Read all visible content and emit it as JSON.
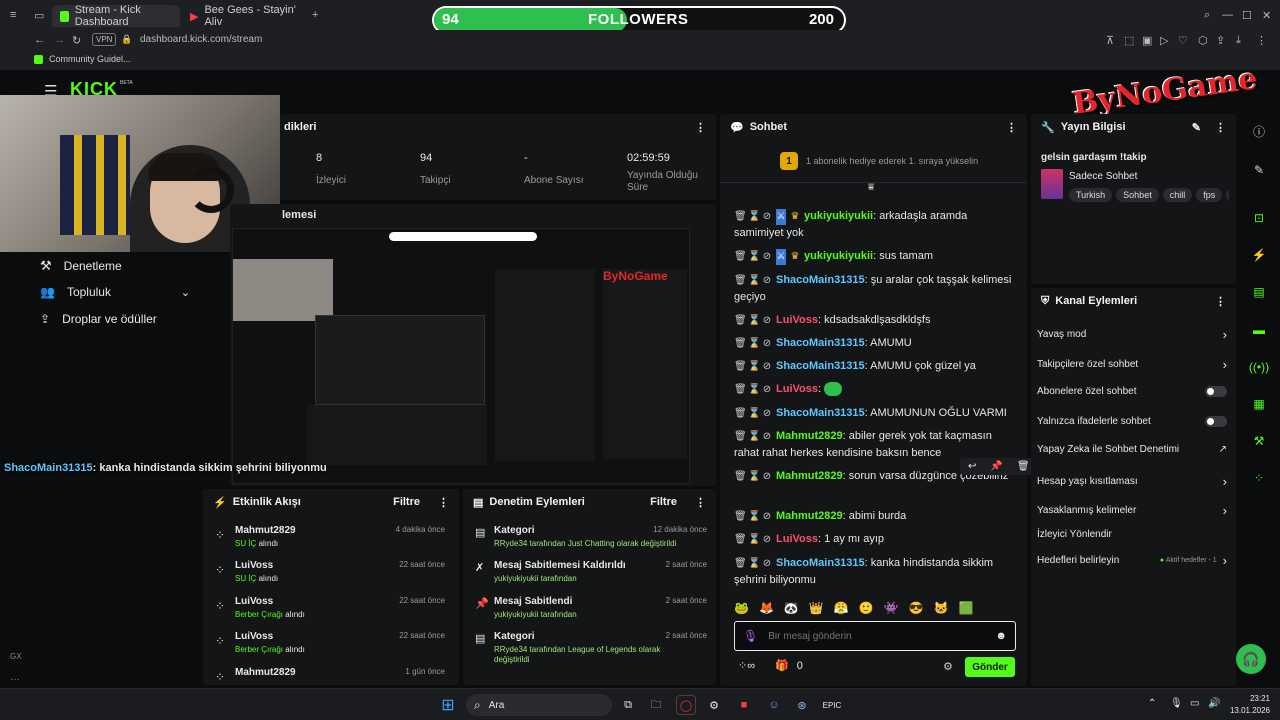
{
  "browser": {
    "tabs": [
      {
        "label": "Stream - Kick Dashboard"
      },
      {
        "label": "Bee Gees - Stayin' Aliv"
      }
    ],
    "url": "dashboard.kick.com/stream",
    "vpn": "VPN",
    "bookmark": "Community Guidel..."
  },
  "followers_bar": {
    "current": "94",
    "label": "FOLLOWERS",
    "goal": "200",
    "fraction": 0.47
  },
  "brand": {
    "logo": "KICK",
    "beta": "BETA",
    "overlay_watermark": "ByNoGame"
  },
  "stats": {
    "title": "dikleri",
    "items": [
      {
        "value": "8",
        "label": "İzleyici"
      },
      {
        "value": "94",
        "label": "Takipçi"
      },
      {
        "value": "-",
        "label": "Abone Sayısı"
      },
      {
        "value": "02:59:59",
        "label": "Yayında Olduğu Süre"
      }
    ]
  },
  "preview": {
    "title": "lemesi"
  },
  "sidebar": {
    "items": [
      {
        "label": "Denetleme"
      },
      {
        "label": "Topluluk"
      },
      {
        "label": "Droplar ve ödüller"
      }
    ]
  },
  "overlay_chat": {
    "user": "ShacoMain31315",
    "text": ": kanka hindistanda sikkim şehrini biliyonmu"
  },
  "activity": {
    "title": "Etkinlik Akışı",
    "filter": "Filtre",
    "items": [
      {
        "user": "Mahmut2829",
        "time": "4 dakika önce",
        "reward": "SU İÇ",
        "suffix": "alındı"
      },
      {
        "user": "LuiVoss",
        "time": "22 saat önce",
        "reward": "SU İÇ",
        "suffix": "alındı"
      },
      {
        "user": "LuiVoss",
        "time": "22 saat önce",
        "reward": "Berber Çırağı",
        "suffix": "alındı"
      },
      {
        "user": "LuiVoss",
        "time": "22 saat önce",
        "reward": "Berber Çırağı",
        "suffix": "alındı"
      },
      {
        "user": "Mahmut2829",
        "time": "1 gün önce",
        "reward": "",
        "suffix": ""
      }
    ]
  },
  "moderation": {
    "title": "Denetim Eylemleri",
    "filter": "Filtre",
    "items": [
      {
        "title": "Kategori",
        "time": "12 dakika önce",
        "line": "RRyde34 tarafından Just Chatting olarak değiştirildi"
      },
      {
        "title": "Mesaj Sabitlemesi Kaldırıldı",
        "time": "2 saat önce",
        "line": "yukiyukiyukii tarafından"
      },
      {
        "title": "Mesaj Sabitlendi",
        "time": "2 saat önce",
        "line": "yukiyukiyukii tarafından"
      },
      {
        "title": "Kategori",
        "time": "2 saat önce",
        "line": "RRyde34 tarafından League of Legends olarak değiştirildi"
      }
    ]
  },
  "chat": {
    "title": "Sohbet",
    "pinned": "1 abonelik hediye ederek 1. sıraya yükselin",
    "pinned_count": "1",
    "messages": [
      {
        "user": "yukiyukiyukii",
        "text": ": arkadaşla aramda samimiyet yok",
        "color": "#53fc18"
      },
      {
        "user": "yukiyukiyukii",
        "text": ": sus tamam",
        "color": "#53fc18"
      },
      {
        "user": "ShacoMain31315",
        "text": ": şu aralar çok taşşak kelimesi geçiyo",
        "color": "#5ec8ff"
      },
      {
        "user": "LuiVoss",
        "text": ": kdsadsakdlşasdkldşfs",
        "color": "#ff4d6d"
      },
      {
        "user": "ShacoMain31315",
        "text": ": AMUMU",
        "color": "#5ec8ff"
      },
      {
        "user": "ShacoMain31315",
        "text": ": AMUMU çok güzel ya",
        "color": "#5ec8ff"
      },
      {
        "user": "LuiVoss",
        "text": ":",
        "color": "#ff4d6d"
      },
      {
        "user": "ShacoMain31315",
        "text": ": AMUMUNUN OĞLU VARMI",
        "color": "#5ec8ff"
      },
      {
        "user": "Mahmut2829",
        "text": ": abiler gerek yok tat kaçmasın rahat rahat herkes kendisine baksın bence",
        "color": "#53fc18"
      },
      {
        "user": "Mahmut2829",
        "text": ": sorun varsa düzgünce çözebiliriz",
        "color": "#53fc18"
      },
      {
        "user": "Mahmut2829",
        "text": ": abimi burda",
        "color": "#53fc18"
      },
      {
        "user": "LuiVoss",
        "text": ": 1 ay mı ayıp",
        "color": "#ff4d6d"
      },
      {
        "user": "ShacoMain31315",
        "text": ": kanka hindistanda sikkim şehrini biliyonmu",
        "color": "#5ec8ff"
      }
    ],
    "input_placeholder": "Bir mesaj gönderin",
    "points": "0",
    "send": "Gönder"
  },
  "stream_info": {
    "title": "Yayın Bilgisi",
    "stream_title": "gelsin gardaşım !takip",
    "category": "Sadece Sohbet",
    "tags": [
      "Turkish",
      "Sohbet",
      "chill",
      "fps",
      "g"
    ]
  },
  "channel_actions": {
    "title": "Kanal Eylemleri",
    "items": [
      {
        "label": "Yavaş mod",
        "kind": "arrow"
      },
      {
        "label": "Takipçilere özel sohbet",
        "kind": "arrow"
      },
      {
        "label": "Abonelere özel sohbet",
        "kind": "toggle"
      },
      {
        "label": "Yalnızca ifadelerle sohbet",
        "kind": "toggle"
      },
      {
        "label": "Yapay Zeka ile Sohbet Denetimi",
        "kind": "external"
      },
      {
        "label": "Hesap yaşı kısıtlaması",
        "kind": "arrow"
      },
      {
        "label": "Yasaklanmış kelimeler",
        "kind": "arrow"
      },
      {
        "label": "İzleyici Yönlendir",
        "kind": "none"
      },
      {
        "label": "Hedefleri belirleyin",
        "kind": "arrow",
        "extra": "Aktif hedefler - 1"
      }
    ]
  },
  "taskbar": {
    "search": "Ara",
    "time": "23:21",
    "date": "13.01.2026"
  },
  "colors": {
    "accent": "#53fc18",
    "panel": "#141517",
    "bg": "#0b0c0d"
  }
}
